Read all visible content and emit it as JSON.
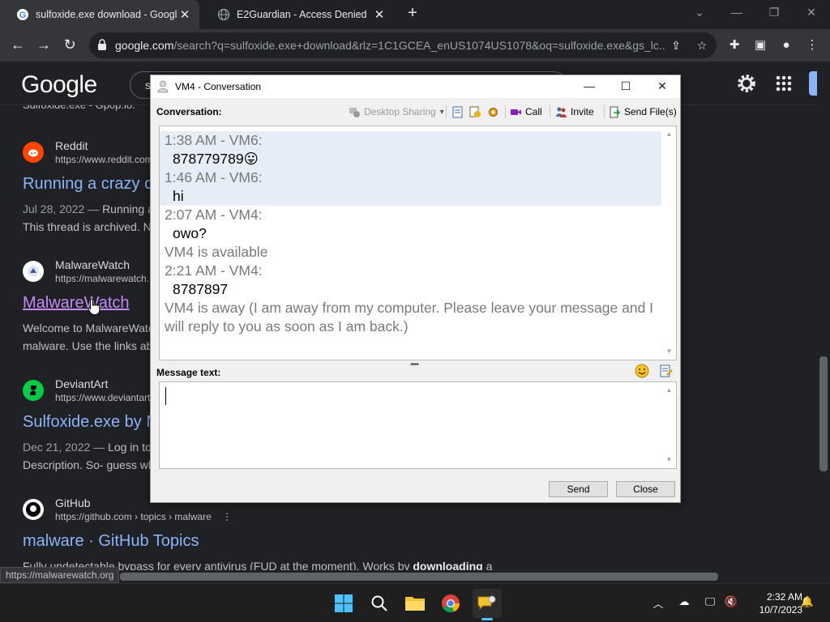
{
  "browser": {
    "tabs": [
      {
        "title": "sulfoxide.exe download - Google",
        "active": true
      },
      {
        "title": "E2Guardian - Access Denied",
        "active": false
      }
    ],
    "url_host": "google.com",
    "url_path": "/search?q=sulfoxide.exe+download&rlz=1C1GCEA_enUS1074US1078&oq=sulfoxide.exe&gs_lc...",
    "status_url": "https://malwarewatch.org"
  },
  "google": {
    "logo": "Google",
    "search_partial": "s",
    "snippet_top": "Sulfoxide.exe - Gpop.io.",
    "results": [
      {
        "name": "Reddit",
        "url": "https://www.reddit.com",
        "title": "Running a crazy c",
        "date": "Jul 28, 2022 — ",
        "desc1": "Running a",
        "desc2": "This thread is archived. N"
      },
      {
        "name": "MalwareWatch",
        "url": "https://malwarewatch.",
        "title": "MalwareWatch",
        "desc1": "Welcome to MalwareWatc",
        "desc2": "malware. Use the links ab"
      },
      {
        "name": "DeviantArt",
        "url": "https://www.deviantart",
        "title": "Sulfoxide.exe by N",
        "date": "Dec 21, 2022 — ",
        "desc1": "Log in to",
        "desc2": "Description. So- guess wh"
      },
      {
        "name": "GitHub",
        "url": "https://github.com › topics › malware",
        "title": "malware · GitHub Topics",
        "desc1": "Fully undetectable bypass for every antivirus (FUD at the moment). Works by ",
        "desc_bold": "downloading",
        "desc_end": " a"
      }
    ]
  },
  "conversation": {
    "window_title": "VM4 - Conversation",
    "conversation_label": "Conversation:",
    "toolbar": {
      "desktop_sharing": "Desktop Sharing",
      "call": "Call",
      "invite": "Invite",
      "send_files": "Send File(s)"
    },
    "messages": [
      {
        "header": "1:38 AM - VM6:",
        "text": "878779789",
        "emoji": "😛",
        "highlight": true
      },
      {
        "header": "1:46 AM - VM6:",
        "text": "hi",
        "highlight": true
      },
      {
        "header": "2:07 AM - VM4:",
        "text": "owo?",
        "highlight": false
      }
    ],
    "status_available": "VM4 is available",
    "message_4": {
      "header": "2:21 AM - VM4:",
      "text": "8787897"
    },
    "status_away": "VM4 is away (I am away from my computer. Please leave your message and I will reply to you as soon as I am back.)",
    "message_label": "Message text:",
    "message_value": "",
    "send_label": "Send",
    "close_label": "Close"
  },
  "taskbar": {
    "time": "2:32 AM",
    "date": "10/7/2023"
  },
  "colors": {
    "chrome_bg": "#202124",
    "chrome_toolbar": "#35363a",
    "link_blue": "#8ab4f8",
    "link_visited": "#c58af9",
    "history_highlight": "#e6edf7",
    "taskbar_accent": "#4cc2ff"
  }
}
